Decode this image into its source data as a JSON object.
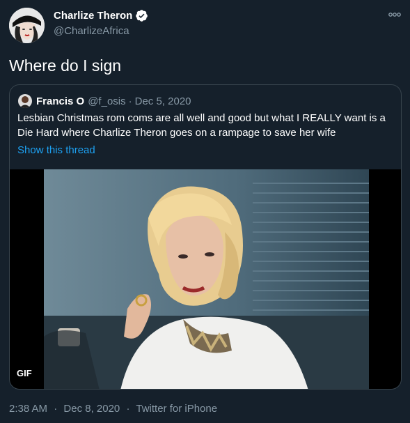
{
  "author": {
    "display_name": "Charlize Theron",
    "handle": "@CharlizeAfrica",
    "verified": true,
    "avatar_icon": "profile-photo"
  },
  "tweet": {
    "text": "Where do I sign"
  },
  "quoted_tweet": {
    "author_name": "Francis O",
    "author_handle": "@f_osis",
    "separator": "·",
    "date": "Dec 5, 2020",
    "text": "Lesbian Christmas rom coms are all well and good but what I REALLY want is a Die Hard where Charlize Theron goes on a rampage to save her wife",
    "show_thread": "Show this thread",
    "media": {
      "badge": "GIF"
    }
  },
  "meta": {
    "time": "2:38 AM",
    "sep1": "·",
    "date": "Dec 8, 2020",
    "sep2": "·",
    "source": "Twitter for iPhone"
  },
  "colors": {
    "background": "#15202b",
    "secondary_text": "#8899a6",
    "link": "#1da1f2",
    "border": "#38444d"
  }
}
